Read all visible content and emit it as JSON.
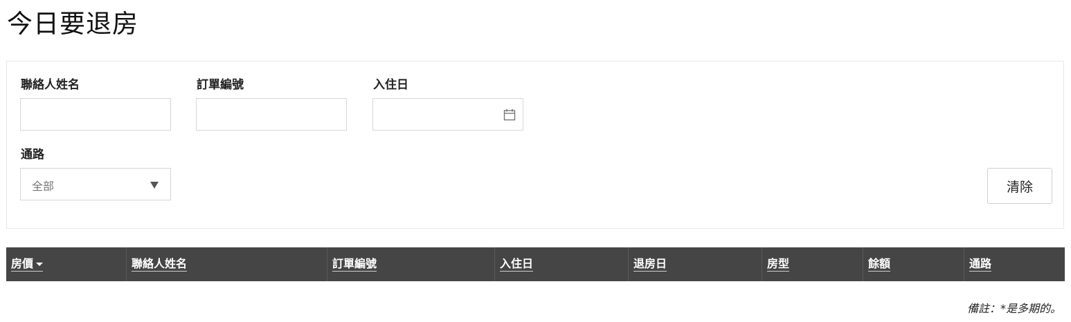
{
  "page": {
    "title": "今日要退房"
  },
  "filters": {
    "contact_name": {
      "label": "聯絡人姓名",
      "value": "",
      "placeholder": ""
    },
    "order_number": {
      "label": "訂單編號",
      "value": "",
      "placeholder": ""
    },
    "checkin_date": {
      "label": "入住日",
      "value": "",
      "placeholder": "",
      "icon": "calendar-icon"
    },
    "channel": {
      "label": "通路",
      "selected": "全部",
      "icon": "triangle-down-icon"
    },
    "clear_label": "清除"
  },
  "table": {
    "columns": [
      {
        "label": "房價",
        "sorted": true,
        "sort_direction": "desc"
      },
      {
        "label": "聯絡人姓名"
      },
      {
        "label": "訂單編號"
      },
      {
        "label": "入住日"
      },
      {
        "label": "退房日"
      },
      {
        "label": "房型"
      },
      {
        "label": "餘額"
      },
      {
        "label": "通路"
      }
    ],
    "rows": []
  },
  "footnote": "備註：*是多期的。",
  "colors": {
    "table_header_bg": "#454545",
    "table_header_text": "#ffffff",
    "panel_border": "#e8e8e8",
    "input_border": "#d6d6d6"
  }
}
